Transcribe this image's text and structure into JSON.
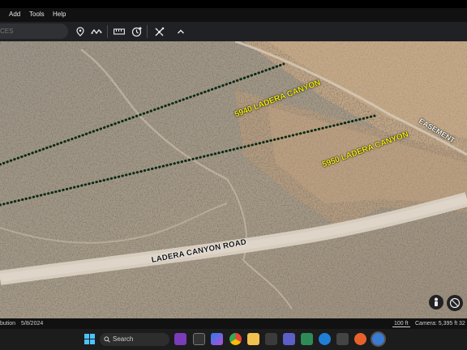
{
  "menu": [
    "Add",
    "Tools",
    "Help"
  ],
  "toolbar": {
    "search_placeholder": "CES"
  },
  "map": {
    "labels": {
      "lot1": "5940 LADERA CANYON",
      "lot2": "5950 LADERA CANYON",
      "road": "LADERA CANYON ROAD",
      "easement": "EASEMENT"
    },
    "label_color": "#f2ea18"
  },
  "status": {
    "attribution": "bution",
    "date": "5/8/2024",
    "scale": "100 ft",
    "camera": "Camera: 5,395 ft",
    "coord": "32"
  },
  "taskbar": {
    "search": "Search"
  }
}
